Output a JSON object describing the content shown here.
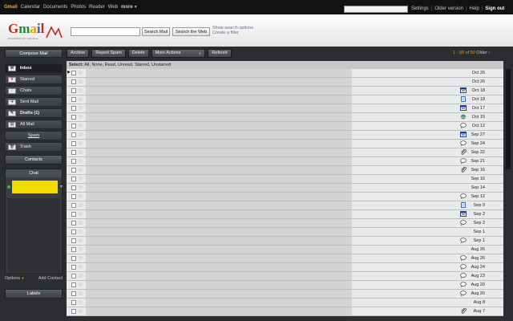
{
  "topnav": {
    "items": [
      "Gmail",
      "Calendar",
      "Documents",
      "Photos",
      "Reader",
      "Web",
      "more"
    ],
    "links": [
      "Settings",
      "Older version",
      "Help",
      "Sign out"
    ]
  },
  "header": {
    "logo_text": "Gmail",
    "logo_sub": "POWERED BY GOOGLE",
    "search_button": "Search Mail",
    "search_web_button": "Search the Web",
    "show_options": "Show search options",
    "create_filter": "Create a filter"
  },
  "sidebar": {
    "compose": "Compose Mail",
    "items": [
      {
        "label": "Inbox",
        "icon": "inbox-icon",
        "active": true
      },
      {
        "label": "Starred",
        "icon": "star-icon"
      },
      {
        "label": "Chats",
        "icon": "chat-icon"
      },
      {
        "label": "Sent Mail",
        "icon": "sent-icon"
      },
      {
        "label": "Drafts (1)",
        "icon": "drafts-icon",
        "bold": true
      },
      {
        "label": "All Mail",
        "icon": "allmail-icon"
      },
      {
        "label": "Spam",
        "icon": null
      },
      {
        "label": "Trash",
        "icon": "trash-icon"
      }
    ],
    "contacts": "Contacts",
    "chat_title": "Chat",
    "chat_options": "Options",
    "add_contact": "Add Contact",
    "labels": "Labels"
  },
  "toolbar": {
    "archive": "Archive",
    "report_spam": "Report Spam",
    "delete": "Delete",
    "more_actions": "More Actions",
    "refresh": "Refresh",
    "range": "1 - 50",
    "of": "of",
    "total": "50",
    "older": "Older ›"
  },
  "selectbar": {
    "label": "Select:",
    "options": "All, None, Read, Unread, Starred, Unstarred"
  },
  "messages": [
    {
      "date": "Oct 26",
      "icon": null
    },
    {
      "date": "Oct 26",
      "icon": null
    },
    {
      "date": "Oct 18",
      "icon": "calendar-icon"
    },
    {
      "date": "Oct 18",
      "icon": "doc-icon"
    },
    {
      "date": "Oct 17",
      "icon": "calendar-icon"
    },
    {
      "date": "Oct 15",
      "icon": "image-icon"
    },
    {
      "date": "Oct 12",
      "icon": "chat-bubble-icon"
    },
    {
      "date": "Sep 27",
      "icon": "calendar-icon"
    },
    {
      "date": "Sep 24",
      "icon": "chat-bubble-icon"
    },
    {
      "date": "Sep 22",
      "icon": "paperclip-icon"
    },
    {
      "date": "Sep 21",
      "icon": "chat-bubble-icon"
    },
    {
      "date": "Sep 16",
      "icon": "paperclip-icon"
    },
    {
      "date": "Sep 16",
      "icon": null
    },
    {
      "date": "Sep 14",
      "icon": null
    },
    {
      "date": "Sep 12",
      "icon": "chat-bubble-icon"
    },
    {
      "date": "Sep 9",
      "icon": "doc-icon"
    },
    {
      "date": "Sep 2",
      "icon": "calendar-icon"
    },
    {
      "date": "Sep 2",
      "icon": "chat-bubble-icon"
    },
    {
      "date": "Sep 1",
      "icon": null
    },
    {
      "date": "Sep 1",
      "icon": "chat-bubble-icon"
    },
    {
      "date": "Aug 26",
      "icon": null
    },
    {
      "date": "Aug 26",
      "icon": "chat-bubble-icon"
    },
    {
      "date": "Aug 24",
      "icon": "chat-bubble-icon"
    },
    {
      "date": "Aug 23",
      "icon": "chat-bubble-icon"
    },
    {
      "date": "Aug 20",
      "icon": "chat-bubble-icon"
    },
    {
      "date": "Aug 20",
      "icon": "chat-bubble-icon"
    },
    {
      "date": "Aug 8",
      "icon": null
    },
    {
      "date": "Aug 7",
      "icon": "paperclip-icon"
    }
  ],
  "colors": {
    "accent": "#f0a81c",
    "topbar": "#121212",
    "chat_status": "#2ec02e",
    "chat_highlight": "#f2dc00"
  }
}
